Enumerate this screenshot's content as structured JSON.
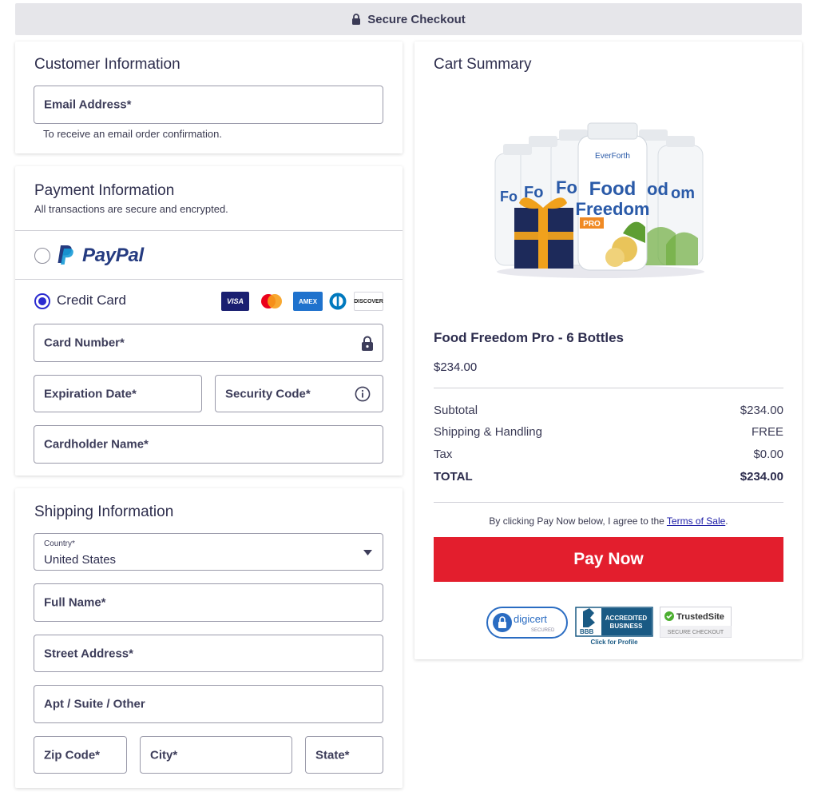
{
  "header": {
    "title": "Secure Checkout",
    "icon": "lock-icon"
  },
  "customer": {
    "title": "Customer Information",
    "email_label": "Email Address*",
    "email_hint": "To receive an email order confirmation."
  },
  "payment": {
    "title": "Payment Information",
    "subtitle": "All transactions are secure and encrypted.",
    "paypal_label": "PayPal",
    "paypal_selected": false,
    "credit_label": "Credit Card",
    "credit_selected": true,
    "card_brands": [
      "VISA",
      "Mastercard",
      "AMEX",
      "Diners",
      "DISCOVER"
    ],
    "card_number_label": "Card Number*",
    "expiration_label": "Expiration Date*",
    "security_label": "Security Code*",
    "cardholder_label": "Cardholder Name*"
  },
  "shipping": {
    "title": "Shipping Information",
    "country_label": "Country*",
    "country_value": "United States",
    "fullname_label": "Full Name*",
    "street_label": "Street Address*",
    "apt_label": "Apt / Suite / Other",
    "zip_label": "Zip Code*",
    "city_label": "City*",
    "state_label": "State*"
  },
  "cart": {
    "title": "Cart Summary",
    "product_image_text": {
      "brand": "EverForth",
      "line1": "Food",
      "line2": "Freedom",
      "tag": "PRO"
    },
    "product_name": "Food Freedom Pro - 6 Bottles",
    "product_price": "$234.00",
    "subtotal_label": "Subtotal",
    "subtotal_value": "$234.00",
    "shipping_label": "Shipping & Handling",
    "shipping_value": "FREE",
    "tax_label": "Tax",
    "tax_value": "$0.00",
    "total_label": "TOTAL",
    "total_value": "$234.00",
    "terms_prefix": "By clicking Pay Now below, I agree to the ",
    "terms_link": "Terms of Sale",
    "terms_suffix": ".",
    "pay_button": "Pay Now",
    "badges": {
      "digicert": "digicert",
      "digicert_sub": "SECURED",
      "bbb_line1": "ACCREDITED",
      "bbb_line2": "BUSINESS",
      "bbb_sub": "Click for Profile",
      "bbb_mark": "BBB",
      "trusted": "TrustedSite",
      "trusted_sub": "SECURE CHECKOUT"
    }
  },
  "colors": {
    "accent": "#2b2bd0",
    "pay_button": "#e31e2d",
    "paypal_dark": "#253b80",
    "paypal_light": "#179bd7"
  }
}
